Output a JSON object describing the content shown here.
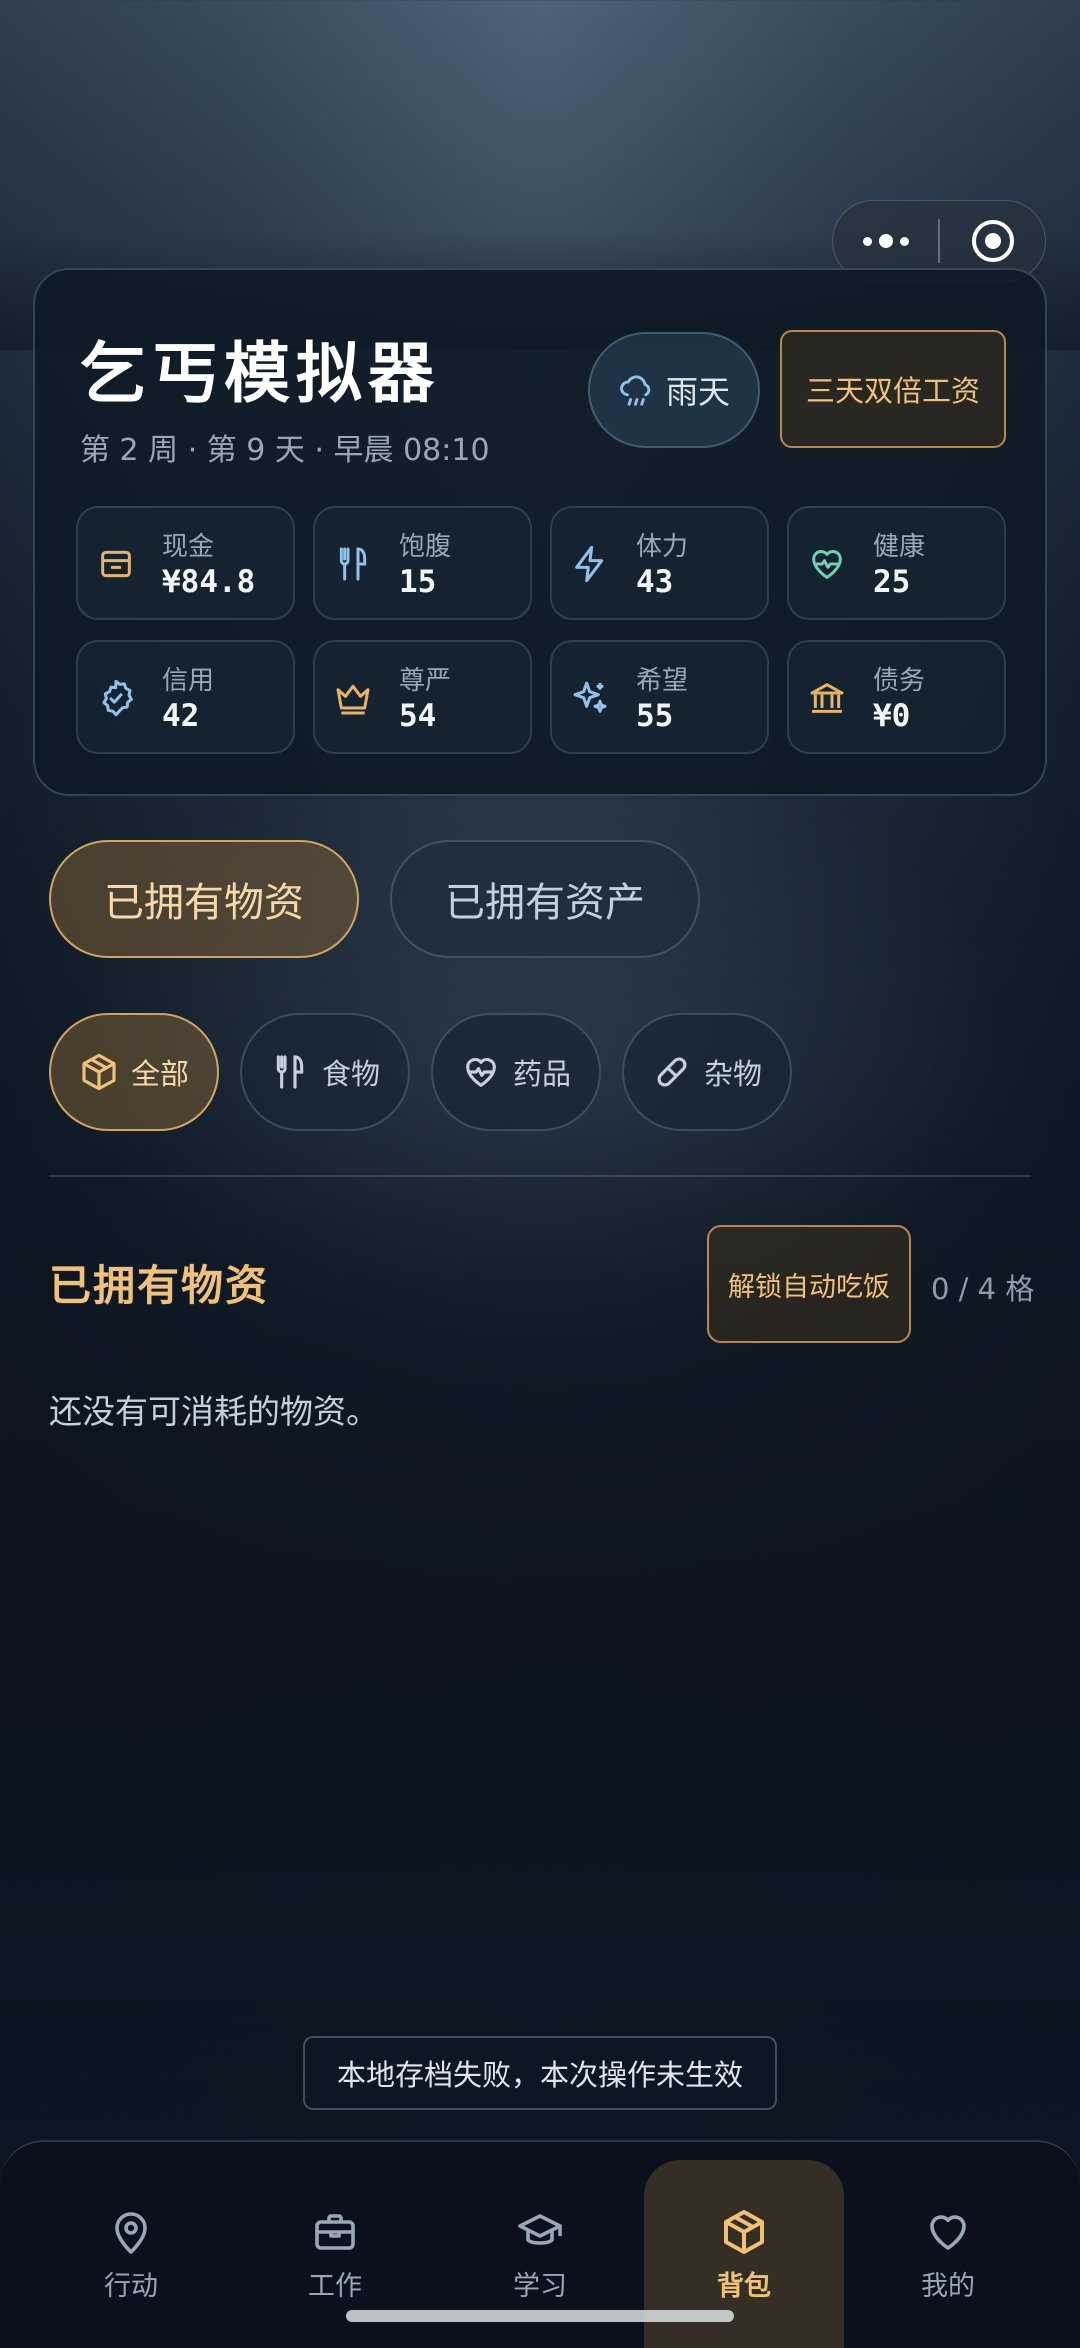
{
  "app": {
    "title": "乞丐模拟器",
    "subtitle": "第 2 周 · 第 9 天 · 早晨 08:10",
    "weather": "雨天",
    "bonus": "三天双倍工资"
  },
  "stats": [
    {
      "label": "现金",
      "value": "¥84.8",
      "icon": "wallet-icon"
    },
    {
      "label": "饱腹",
      "value": "15",
      "icon": "utensils-icon"
    },
    {
      "label": "体力",
      "value": "43",
      "icon": "lightning-icon"
    },
    {
      "label": "健康",
      "value": "25",
      "icon": "heart-pulse-icon"
    },
    {
      "label": "信用",
      "value": "42",
      "icon": "badge-check-icon"
    },
    {
      "label": "尊严",
      "value": "54",
      "icon": "crown-icon"
    },
    {
      "label": "希望",
      "value": "55",
      "icon": "sparkles-icon"
    },
    {
      "label": "债务",
      "value": "¥0",
      "icon": "bank-icon"
    }
  ],
  "tabs": {
    "owned_goods": "已拥有物资",
    "owned_assets": "已拥有资产"
  },
  "filters": [
    {
      "label": "全部",
      "icon": "box-icon"
    },
    {
      "label": "食物",
      "icon": "utensils-icon"
    },
    {
      "label": "药品",
      "icon": "heart-pulse-icon"
    },
    {
      "label": "杂物",
      "icon": "pill-icon"
    }
  ],
  "section": {
    "title": "已拥有物资",
    "auto_eat": "解锁自动吃饭",
    "slots": "0 / 4 格",
    "empty": "还没有可消耗的物资。"
  },
  "toast": "本地存档失败，本次操作未生效",
  "nav": [
    {
      "label": "行动",
      "icon": "map-pin-icon"
    },
    {
      "label": "工作",
      "icon": "briefcase-icon"
    },
    {
      "label": "学习",
      "icon": "graduation-cap-icon"
    },
    {
      "label": "背包",
      "icon": "box-icon"
    },
    {
      "label": "我的",
      "icon": "heart-icon"
    }
  ],
  "colors": {
    "accent": "#f0c176",
    "accent_border": "#d4a45e",
    "stat_icon_gold": "#e8b463",
    "stat_icon_blue": "#8fc3ea",
    "stat_icon_green": "#6fd3b0"
  }
}
